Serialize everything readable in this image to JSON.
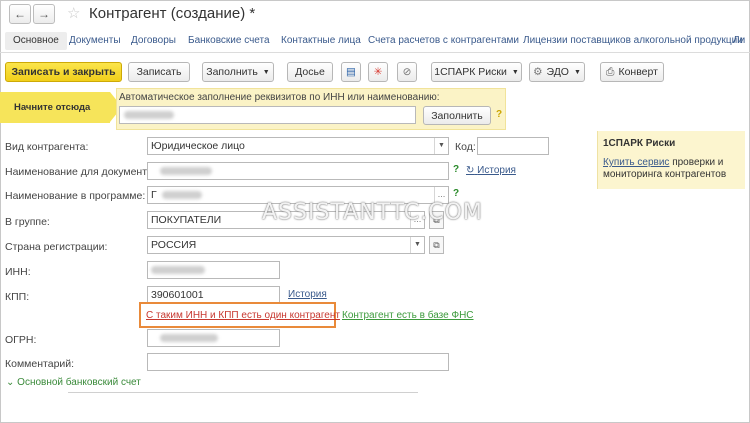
{
  "window": {
    "title": "Контрагент (создание) *"
  },
  "nav": {
    "back": "←",
    "forward": "→",
    "favorite": "☆"
  },
  "tabs": [
    "Основное",
    "Документы",
    "Договоры",
    "Банковские счета",
    "Контактные лица",
    "Счета расчетов с контрагентами",
    "Лицензии поставщиков алкогольной продукции",
    "Ли"
  ],
  "toolbar": {
    "save_close": "Записать и закрыть",
    "save": "Записать",
    "fill": "Заполнить",
    "dossier": "Досье",
    "spark": "1СПАРК Риски",
    "edo": "ЭДО",
    "envelope": "Конверт"
  },
  "hint": {
    "start_here": "Начните отсюда"
  },
  "autofill": {
    "label": "Автоматическое заполнение реквизитов по ИНН или наименованию:",
    "button": "Заполнить",
    "help": "?"
  },
  "form": {
    "kind_label": "Вид контрагента:",
    "kind_value": "Юридическое лицо",
    "code_label": "Код:",
    "docname_label": "Наименование для документов:",
    "history_link": "История",
    "progname_label": "Наименование в программе:",
    "progname_prefix": "Г",
    "group_label": "В группе:",
    "group_value": "ПОКУПАТЕЛИ",
    "country_label": "Страна регистрации:",
    "country_value": "РОССИЯ",
    "inn_label": "ИНН:",
    "kpp_label": "КПП:",
    "kpp_value": "390601001",
    "kpp_history": "История",
    "same_inn_link": "С таким ИНН и КПП есть один контрагент",
    "fns_link": "Контрагент есть в базе ФНС",
    "ogrn_label": "ОГРН:",
    "comment_label": "Комментарий:",
    "bank_section": "Основной банковский счет",
    "help": "?"
  },
  "side_panel": {
    "title": "1СПАРК Риски",
    "link": "Купить сервис",
    "text": "проверки и мониторинга контрагентов"
  },
  "watermark": "ASSISTANTTC.COM"
}
